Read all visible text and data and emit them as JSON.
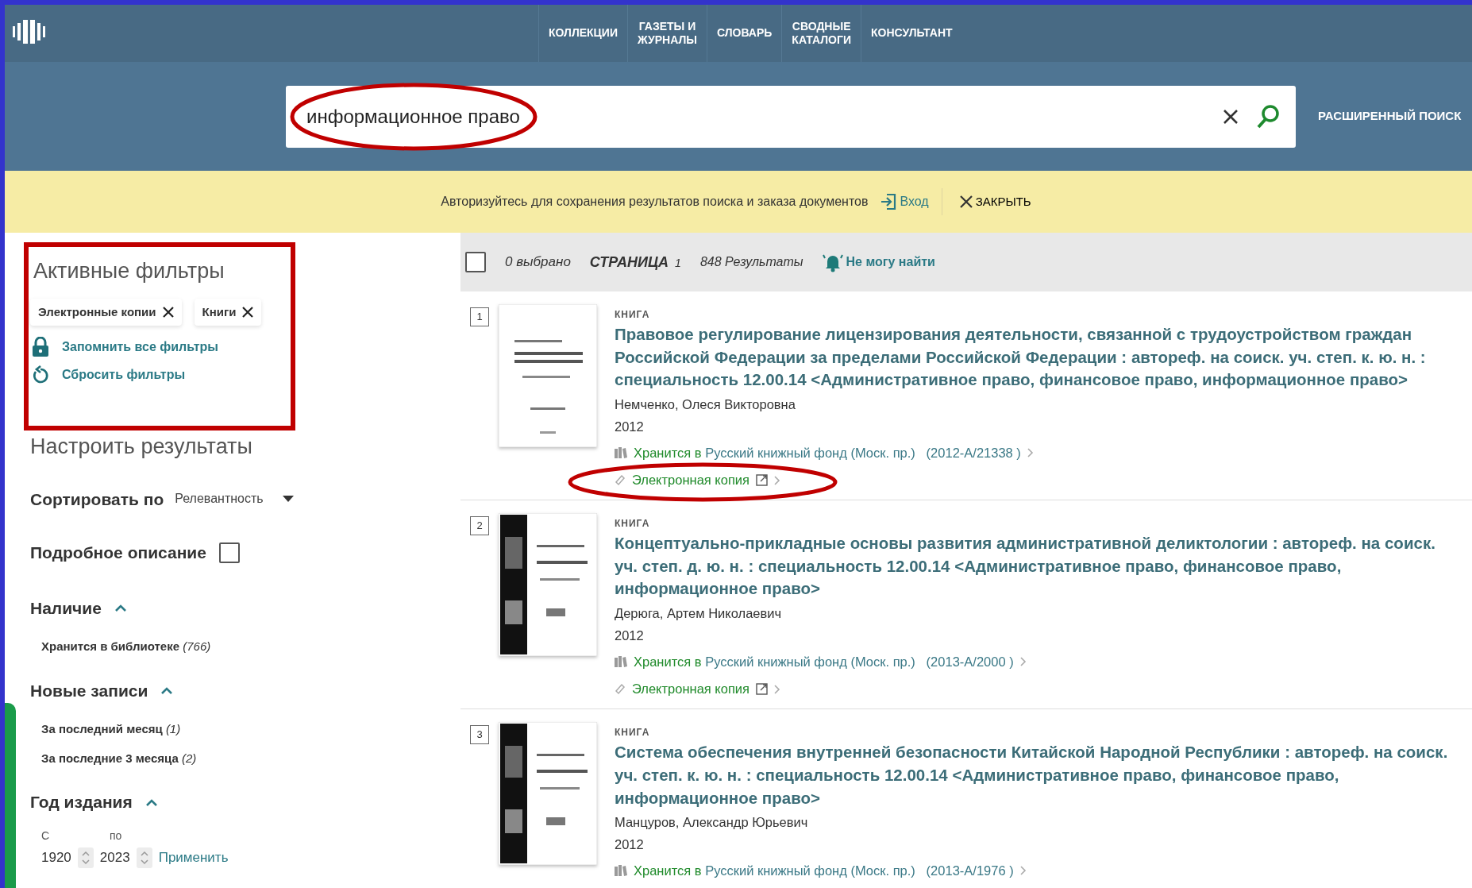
{
  "nav": {
    "items": [
      {
        "label": "КОЛЛЕКЦИИ"
      },
      {
        "label": "ГАЗЕТЫ И\nЖУРНАЛЫ"
      },
      {
        "label": "СЛОВАРЬ"
      },
      {
        "label": "СВОДНЫЕ\nКАТАЛОГИ"
      },
      {
        "label": "КОНСУЛЬТАНТ"
      }
    ]
  },
  "search": {
    "value": "информационное право",
    "advanced": "РАСШИРЕННЫЙ ПОИСК"
  },
  "banner": {
    "text": "Авторизуйтесь для сохранения результатов поиска и заказа документов",
    "login": "Вход",
    "close": "ЗАКРЫТЬ"
  },
  "sidebar": {
    "active_title": "Активные фильтры",
    "chips": [
      {
        "label": "Электронные копии"
      },
      {
        "label": "Книги"
      }
    ],
    "actions": [
      {
        "kind": "lock",
        "label": "Запомнить все фильтры"
      },
      {
        "kind": "reset",
        "label": "Сбросить фильтры"
      }
    ],
    "customize_title": "Настроить результаты",
    "sort": {
      "label": "Сортировать по",
      "value": "Релевантность"
    },
    "detailed": {
      "label": "Подробное описание",
      "checked": false
    },
    "facets": [
      {
        "title": "Наличие",
        "expanded": true,
        "items": [
          {
            "label": "Хранится в библиотеке",
            "count": "(766)"
          }
        ]
      },
      {
        "title": "Новые записи",
        "expanded": true,
        "items": [
          {
            "label": "За последний месяц",
            "count": "(1)"
          },
          {
            "label": "За последние 3 месяца",
            "count": "(2)"
          }
        ]
      }
    ],
    "year": {
      "title": "Год издания",
      "expanded": true,
      "from_label": "С",
      "to_label": "по",
      "from": "1920",
      "to": "2023",
      "apply": "Применить"
    }
  },
  "results_header": {
    "checked": false,
    "selected": "0 выбрано",
    "page_label": "СТРАНИЦА",
    "page": "1",
    "count": "848 Результаты",
    "cant_find": "Не могу найти"
  },
  "results": [
    {
      "number": "1",
      "type": "КНИГА",
      "title": "Правовое регулирование лицензирования деятельности, связанной с трудоустройством граждан Российской Федерации за пределами Российской Федерации : автореф. на соиск. уч. степ. к. ю. н. : специальность 12.00.14 <Административное право, финансовое право, информационное право>",
      "author": "Немченко, Олеся Викторовна",
      "year": "2012",
      "holding_prefix": "Хранится в",
      "holding_location": "Русский книжный фонд (Моск. пр.)",
      "holding_code": "(2012-A/21338 )",
      "ecopy": "Электронная копия"
    },
    {
      "number": "2",
      "type": "КНИГА",
      "title": "Концептуально-прикладные основы развития административной деликтологии : автореф. на соиск. уч. степ. д. ю. н. : специальность 12.00.14 <Административное право, финансовое право, информационное право>",
      "author": "Дерюга, Артем Николаевич",
      "year": "2012",
      "holding_prefix": "Хранится в",
      "holding_location": "Русский книжный фонд (Моск. пр.)",
      "holding_code": "(2013-A/2000 )",
      "ecopy": "Электронная копия"
    },
    {
      "number": "3",
      "type": "КНИГА",
      "title": "Система обеспечения внутренней безопасности Китайской Народной Республики : автореф. на соиск. уч. степ. к. ю. н. : специальность 12.00.14 <Административное право, финансовое право, информационное право>",
      "author": "Манцуров, Александр Юрьевич",
      "year": "2012",
      "holding_prefix": "Хранится в",
      "holding_location": "Русский книжный фонд (Моск. пр.)",
      "holding_code": "(2013-A/1976 )"
    }
  ]
}
